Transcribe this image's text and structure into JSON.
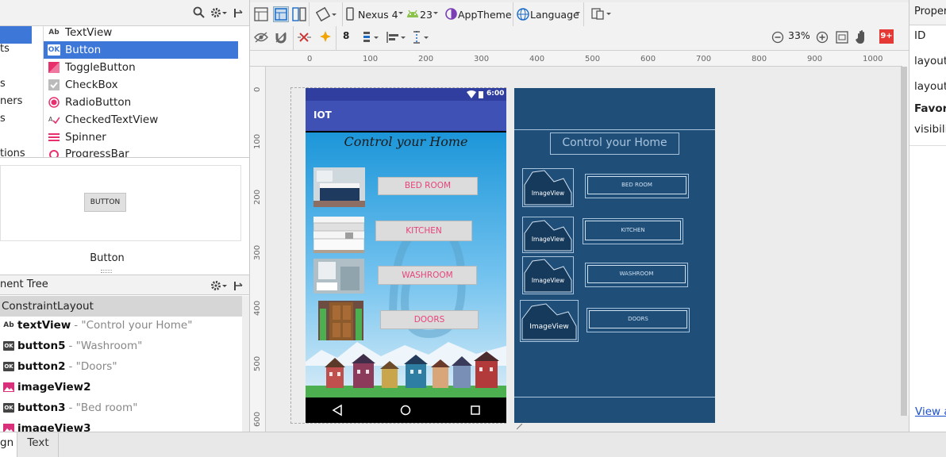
{
  "palette": {
    "categories": [
      "ts",
      "",
      "s",
      "ners",
      "s",
      "",
      "",
      "tions"
    ],
    "items": [
      {
        "label": "TextView",
        "icon": "Ab"
      },
      {
        "label": "Button",
        "icon": "OK"
      },
      {
        "label": "ToggleButton",
        "icon": "toggle"
      },
      {
        "label": "CheckBox",
        "icon": "check"
      },
      {
        "label": "RadioButton",
        "icon": "radio"
      },
      {
        "label": "CheckedTextView",
        "icon": "checked"
      },
      {
        "label": "Spinner",
        "icon": "spinner"
      },
      {
        "label": "ProgressBar",
        "icon": "progress"
      }
    ],
    "preview_button": "BUTTON",
    "component_name": "Button"
  },
  "tree": {
    "header": "nent Tree",
    "root": "ConstraintLayout",
    "rows": [
      {
        "icon": "Ab",
        "name": "textView",
        "detail": "- \"Control your Home\""
      },
      {
        "icon": "OK",
        "name": "button5",
        "detail": "- \"Washroom\""
      },
      {
        "icon": "OK",
        "name": "button2",
        "detail": "- \"Doors\""
      },
      {
        "icon": "img",
        "name": "imageView2",
        "detail": ""
      },
      {
        "icon": "OK",
        "name": "button3",
        "detail": "- \"Bed room\""
      },
      {
        "icon": "img",
        "name": "imageView3",
        "detail": ""
      }
    ]
  },
  "toolbar": {
    "device": "Nexus 4",
    "api": "23",
    "theme": "AppTheme",
    "language": "Language",
    "zoom": "33%",
    "badge": "9+"
  },
  "rulers": {
    "h": [
      "0",
      "100",
      "200",
      "300",
      "400",
      "500",
      "600",
      "700",
      "800",
      "900",
      "1000"
    ],
    "v": [
      "0",
      "100",
      "200",
      "300",
      "400",
      "500",
      "600"
    ]
  },
  "phone": {
    "time": "6:00",
    "app_title": "IOT",
    "heading": "Control your Home",
    "buttons": [
      "BED ROOM",
      "KITCHEN",
      "WASHROOM",
      "DOORS"
    ]
  },
  "blueprint": {
    "heading": "Control your Home",
    "image_label": "ImageView",
    "buttons": [
      "BED ROOM",
      "KITCHEN",
      "WASHROOM",
      "DOORS"
    ]
  },
  "properties": {
    "header": "Propert",
    "labels": [
      "ID",
      "layout",
      "layout",
      "Favor",
      "visibili"
    ],
    "link": "View a"
  },
  "tabs": {
    "design": "gn",
    "text": "Text"
  },
  "colors": {
    "accent": "#3d78d8",
    "appbar": "#3f51b5",
    "blueprint": "#1f4e79",
    "button_text": "#e8437a"
  }
}
